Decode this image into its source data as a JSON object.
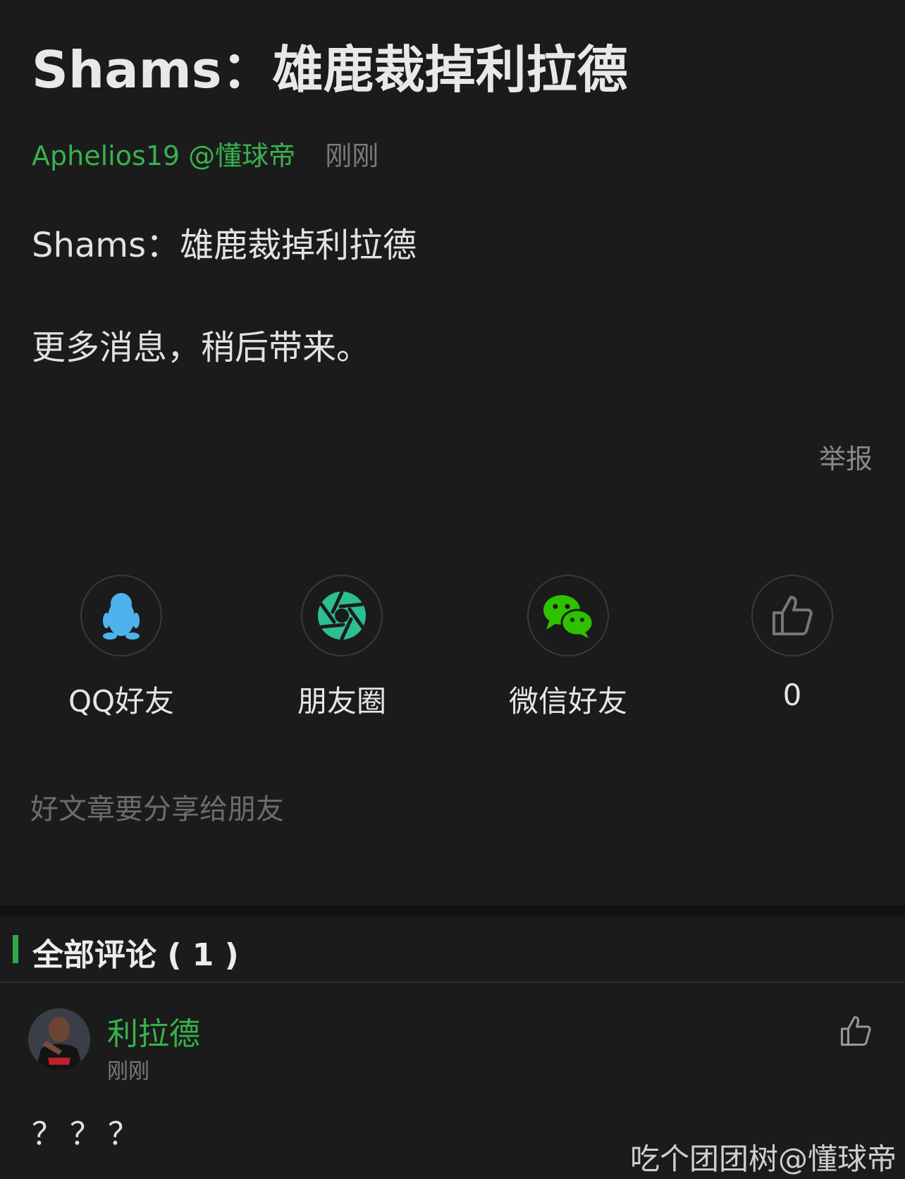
{
  "article": {
    "title": "Shams：雄鹿裁掉利拉德",
    "author": "Aphelios19 @懂球帝",
    "time": "刚刚",
    "paragraphs": [
      "Shams：雄鹿裁掉利拉德",
      "更多消息，稍后带来。"
    ],
    "report_label": "举报"
  },
  "share": {
    "items": [
      {
        "icon": "qq-penguin-icon",
        "label": "QQ好友"
      },
      {
        "icon": "moments-aperture-icon",
        "label": "朋友圈"
      },
      {
        "icon": "wechat-icon",
        "label": "微信好友"
      },
      {
        "icon": "thumbs-up-icon",
        "label": "0"
      }
    ],
    "hint": "好文章要分享给朋友"
  },
  "comments": {
    "header": "全部评论 ( 1 )",
    "list": [
      {
        "author": "利拉德",
        "time": "刚刚",
        "text": "？？？",
        "avatar": "player-avatar"
      }
    ]
  },
  "watermark": "吃个团团树@懂球帝",
  "colors": {
    "background": "#1b1b1b",
    "accent_green": "#37b24d",
    "qq_blue": "#4fb2ee",
    "moments_teal": "#2bbf92",
    "wechat_green": "#2dc100"
  }
}
